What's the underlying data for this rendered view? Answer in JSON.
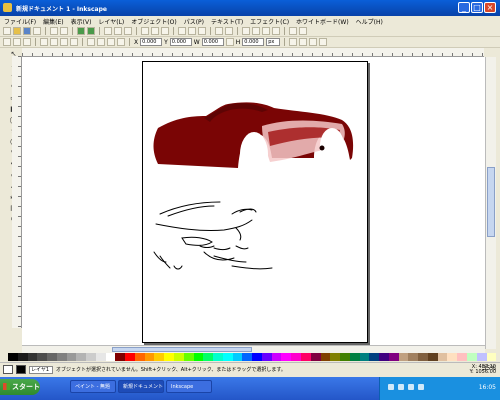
{
  "window": {
    "title": "新規ドキュメント 1 - Inkscape"
  },
  "menu": [
    "ファイル(F)",
    "編集(E)",
    "表示(V)",
    "レイヤ(L)",
    "オブジェクト(O)",
    "パス(P)",
    "テキスト(T)",
    "エフェクト(C)",
    "ホワイトボード(W)",
    "ヘルプ(H)"
  ],
  "toolbar2": {
    "x_label": "X",
    "x_value": "0.000",
    "y_label": "Y",
    "y_value": "0.000",
    "w_label": "W",
    "w_value": "0.000",
    "h_label": "H",
    "h_value": "0.000",
    "unit": "px"
  },
  "status": {
    "layer": "レイヤ1",
    "message": "オブジェクトが選択されていません。Shift+クリック、Alt+クリック、またはドラッグで選択します。",
    "coords_x": "X: 487.10",
    "coords_y": "Y: 1056.00",
    "zoom": "35%"
  },
  "taskbar": {
    "start": "スタート",
    "tasks": [
      "ペイント - 無題",
      "新規ドキュメント 1",
      "Inkscape"
    ],
    "clock": "16:05"
  },
  "palette": [
    "#000000",
    "#1a1a1a",
    "#333333",
    "#4d4d4d",
    "#666666",
    "#808080",
    "#999999",
    "#b3b3b3",
    "#cccccc",
    "#e6e6e6",
    "#ffffff",
    "#800000",
    "#ff0000",
    "#ff6600",
    "#ff9900",
    "#ffcc00",
    "#ffff00",
    "#ccff00",
    "#66ff00",
    "#00ff00",
    "#00ff66",
    "#00ffcc",
    "#00ffff",
    "#00ccff",
    "#0066ff",
    "#0000ff",
    "#6600ff",
    "#cc00ff",
    "#ff00ff",
    "#ff00cc",
    "#ff0066",
    "#800040",
    "#804000",
    "#808000",
    "#408000",
    "#008040",
    "#008080",
    "#004080",
    "#400080",
    "#800080",
    "#c0a080",
    "#a08060",
    "#806040",
    "#604020",
    "#e0c0a0",
    "#ffe0c0",
    "#ffc0c0",
    "#c0ffc0",
    "#c0c0ff",
    "#ffffc0"
  ],
  "colors": {
    "car_body": "#7a0505",
    "car_highlight": "#f4c8c8",
    "wheel_well": "#ffffff"
  }
}
